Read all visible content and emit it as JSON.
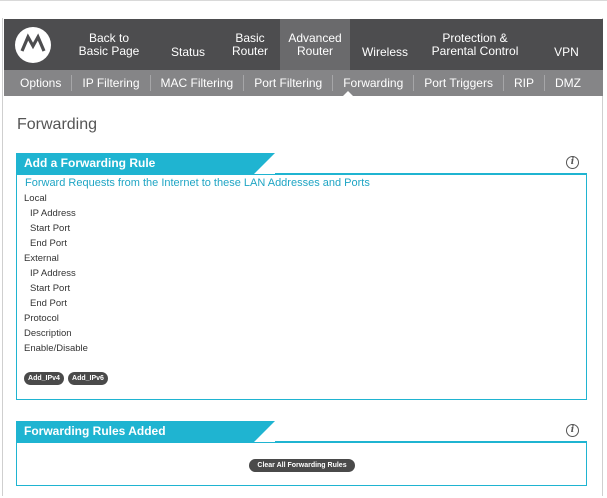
{
  "nav": {
    "logo_icon": "motorola-logo-icon",
    "items": [
      {
        "label": "Back to\nBasic Page",
        "active": false
      },
      {
        "label": "Status",
        "active": false
      },
      {
        "label": "Basic\nRouter",
        "active": false
      },
      {
        "label": "Advanced\nRouter",
        "active": true
      },
      {
        "label": "Wireless",
        "active": false
      },
      {
        "label": "Protection &\nParental Control",
        "active": false
      },
      {
        "label": "VPN",
        "active": false
      }
    ]
  },
  "subnav": {
    "items": [
      "Options",
      "IP Filtering",
      "MAC Filtering",
      "Port Filtering",
      "Forwarding",
      "Port Triggers",
      "RIP",
      "DMZ"
    ],
    "active": "Forwarding"
  },
  "page": {
    "title": "Forwarding"
  },
  "add_rule_panel": {
    "title": "Add a Forwarding Rule",
    "intro": "Forward Requests from the Internet to these LAN Addresses and Ports",
    "labels": {
      "local": "Local",
      "local_ip": "IP Address",
      "local_start": "Start Port",
      "local_end": "End Port",
      "external": "External",
      "external_ip": "IP Address",
      "external_start": "Start Port",
      "external_end": "End Port",
      "protocol": "Protocol",
      "description": "Description",
      "enable": "Enable/Disable"
    },
    "buttons": {
      "add_ipv4": "Add_IPv4",
      "add_ipv6": "Add_IPv6"
    }
  },
  "rules_added_panel": {
    "title": "Forwarding Rules Added",
    "clear_button": "Clear All Forwarding Rules"
  },
  "colors": {
    "accent": "#1fb4d1",
    "nav_dark": "#4d4d4f",
    "nav_active": "#6a6a6c",
    "subnav": "#858587"
  }
}
